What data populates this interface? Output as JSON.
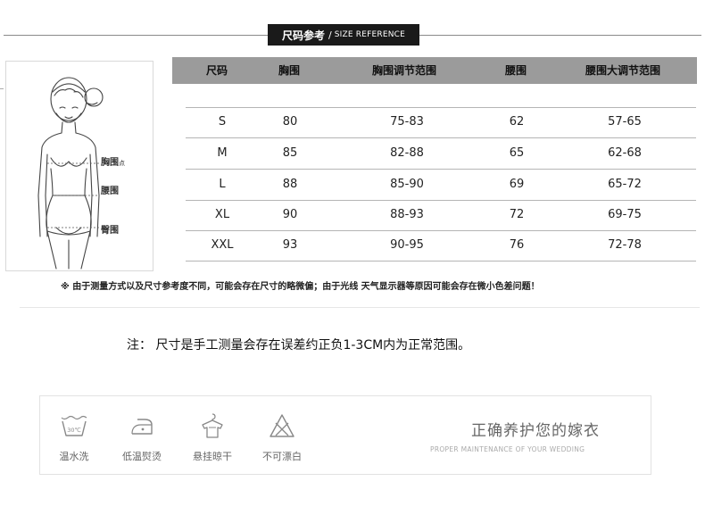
{
  "header": {
    "title_cn": "尺码参考",
    "separator": "/",
    "title_en": "SIZE REFERENCE"
  },
  "figure": {
    "labels": {
      "bust": "胸围",
      "bust_suffix": "点",
      "waist": "腰围",
      "hip": "臀围"
    }
  },
  "size_table": {
    "columns": [
      "尺码",
      "胸围",
      "胸围调节范围",
      "腰围",
      "腰围大调节范围"
    ],
    "rows": [
      [
        "S",
        "80",
        "75-83",
        "62",
        "57-65"
      ],
      [
        "M",
        "85",
        "82-88",
        "65",
        "62-68"
      ],
      [
        "L",
        "88",
        "85-90",
        "69",
        "65-72"
      ],
      [
        "XL",
        "90",
        "88-93",
        "72",
        "69-75"
      ],
      [
        "XXL",
        "93",
        "90-95",
        "76",
        "72-78"
      ]
    ]
  },
  "note_small": "※ 由于测量方式以及尺寸参考度不同，可能会存在尺寸的略微偏；由于光线 天气显示器等原因可能会存在微小色差问题！",
  "note_main": "注：  尺寸是手工测量会存在误差约正负1-3CM内为正常范围。",
  "care": {
    "title": "正确养护您的嫁衣",
    "subtitle": "PROPER MAINTENANCE OF YOUR WEDDING",
    "items": [
      {
        "label": "温水洗",
        "icon": "wash-30-icon",
        "icon_text": "30℃"
      },
      {
        "label": "低温熨烫",
        "icon": "low-iron-icon"
      },
      {
        "label": "悬挂晾干",
        "icon": "hang-dry-icon"
      },
      {
        "label": "不可漂白",
        "icon": "no-bleach-icon"
      }
    ]
  }
}
